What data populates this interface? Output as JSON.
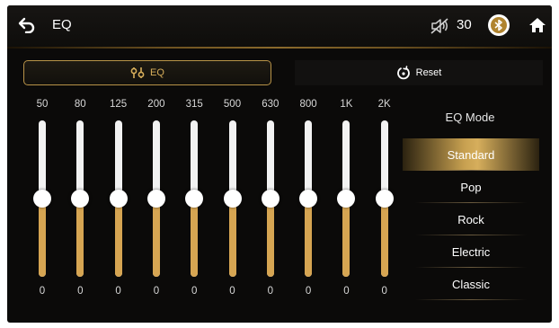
{
  "header": {
    "title": "EQ",
    "volume": "30",
    "icons": {
      "back": "back-arrow-icon",
      "mute": "speaker-mute-icon",
      "bluetooth": "bluetooth-icon",
      "home": "home-icon"
    }
  },
  "tabs": {
    "eq_label": "EQ",
    "reset_label": "Reset"
  },
  "bands": [
    {
      "freq": "50",
      "value": "0"
    },
    {
      "freq": "80",
      "value": "0"
    },
    {
      "freq": "125",
      "value": "0"
    },
    {
      "freq": "200",
      "value": "0"
    },
    {
      "freq": "315",
      "value": "0"
    },
    {
      "freq": "500",
      "value": "0"
    },
    {
      "freq": "630",
      "value": "0"
    },
    {
      "freq": "800",
      "value": "0"
    },
    {
      "freq": "1K",
      "value": "0"
    },
    {
      "freq": "2K",
      "value": "0"
    }
  ],
  "eq_mode": {
    "title": "EQ Mode",
    "selected": "Standard",
    "options": [
      "Standard",
      "Pop",
      "Rock",
      "Electric",
      "Classic"
    ]
  },
  "colors": {
    "accent": "#d6a552",
    "background": "#0b0a09",
    "track": "#f2f2f2"
  }
}
